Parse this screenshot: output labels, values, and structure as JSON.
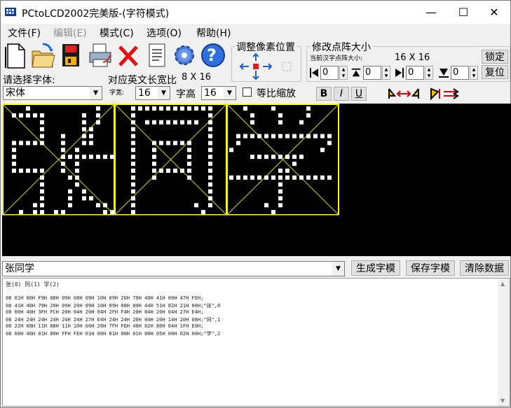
{
  "window": {
    "title": "PCtoLCD2002完美版-(字符模式)",
    "minimize_glyph": "—",
    "maximize_glyph": "☐",
    "close_glyph": "✕"
  },
  "menu": [
    {
      "label": "文件(F)",
      "enabled": true
    },
    {
      "label": "编辑(E)",
      "enabled": false
    },
    {
      "label": "模式(C)",
      "enabled": true
    },
    {
      "label": "选项(O)",
      "enabled": true
    },
    {
      "label": "帮助(H)",
      "enabled": true
    }
  ],
  "toolbar": {
    "icons": [
      "new-file-icon",
      "open-folder-icon",
      "save-disk-icon",
      "print-icon",
      "delete-x-icon",
      "notepad-icon",
      "settings-gear-icon",
      "help-icon"
    ],
    "help_glyph": "?"
  },
  "adjust_group": {
    "title": "调整像素位置"
  },
  "resize_group": {
    "title": "修改点阵大小",
    "current_label": "当前汉字点阵大小:",
    "current_value": "16 X 16",
    "lock_button": "锁定",
    "restore_button": "复位",
    "spin_values": [
      "0",
      "0",
      "0",
      "0"
    ]
  },
  "font_panel": {
    "select_font_label": "请选择字体:",
    "ratio_label": "对应英文长宽比",
    "ratio_value": "8 X 16",
    "font_value": "宋体",
    "width_label": "字宽:",
    "width_value": "16",
    "height_label": "字高",
    "height_value": "16",
    "proportional_label": "等比缩放",
    "bold": "B",
    "italic": "I",
    "underline": "U"
  },
  "input": {
    "text": "张同学",
    "generate_button": "生成字模",
    "save_button": "保存字模",
    "clear_button": "清除数据"
  },
  "output": {
    "header": "张(0) 同(1) 学(2)",
    "lines": [
      "08 01H 00H F9H 08H 09H 08H 09H 10H 09H 20H 79H 40H 41H 00H 47H FEH;",
      "08 41H 40H 79H 20H 09H 20H 09H 10H 09H 08H 09H 44H 51H 82H 21H 00H;\"张\",0",
      "08 00H 40H 3FH FCH 20H 04H 20H 04H 2FH F4H 20H 04H 20H 04H 27H E4H;",
      "08 24H 24H 24H 24H 24H 24H 27H E4H 24H 24H 20H 04H 20H 14H 20H 08H;\"同\",1",
      "08 22H 08H 11H 08H 11H 10H 00H 20H 7FH FEH 40H 02H 80H 04H 1FH E0H;",
      "08 00H 40H 01H 80H FFH FEH 01H 00H 01H 00H 01H 00H 05H 00H 02H 00H;\"学\",2"
    ]
  },
  "glyph_cells": [
    {
      "char": "张",
      "rows": [
        "0001000000000100",
        "0111110000010100",
        "0000010000010100",
        "0000010000011000",
        "0000010010011000",
        "0111110010011000",
        "0100000010100000",
        "0100000011111111",
        "0100000010100000",
        "0111110010100000",
        "0000010001100000",
        "0000010000100000",
        "0000010001010000",
        "0000010001011000",
        "0000110001000110",
        "0010110110000011"
      ]
    },
    {
      "char": "同",
      "rows": [
        "0011111111111100",
        "0010000000000100",
        "0010111111110100",
        "0010000000000100",
        "0010000000000100",
        "0010011111100100",
        "0010010000100100",
        "0010010000100100",
        "0010010000100100",
        "0010011111100100",
        "0010010000100100",
        "0010000000000100",
        "0010000000000100",
        "0010000000000100",
        "0010000000010100",
        "0010000000001000"
      ]
    },
    {
      "char": "学",
      "rows": [
        "0010001000010000",
        "0001000100010000",
        "0001000100100000",
        "0000000000000000",
        "0111111111111110",
        "0100000000000010",
        "1000000000000100",
        "0001111111100000",
        "0000000001000000",
        "0000000110000000",
        "1111111111111110",
        "0000000100000000",
        "0000000100000000",
        "0000000100000000",
        "0000010100000000",
        "0000001000000000"
      ]
    }
  ]
}
